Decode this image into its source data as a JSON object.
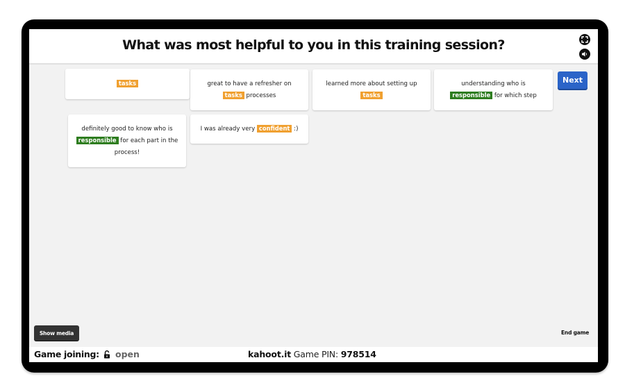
{
  "header": {
    "question": "What was most helpful to you in this training session?",
    "fullscreen_icon": "fullscreen-icon",
    "volume_icon": "volume-icon"
  },
  "responses": [
    {
      "parts": [
        {
          "text": "tasks",
          "kw": "orange"
        }
      ]
    },
    {
      "parts": [
        {
          "text": "great to have a refresher on "
        },
        {
          "text": "tasks",
          "kw": "orange"
        },
        {
          "text": " processes"
        }
      ]
    },
    {
      "parts": [
        {
          "text": "learned more about setting up "
        },
        {
          "text": "tasks",
          "kw": "orange"
        }
      ]
    },
    {
      "parts": [
        {
          "text": "understanding who is "
        },
        {
          "text": "responsible",
          "kw": "green"
        },
        {
          "text": " for which step"
        }
      ]
    },
    {
      "parts": [
        {
          "text": "definitely good to know who is "
        },
        {
          "text": "responsible",
          "kw": "green"
        },
        {
          "text": " for each part in the process!"
        }
      ]
    },
    {
      "parts": [
        {
          "text": "I was already very "
        },
        {
          "text": "confident",
          "kw": "orange"
        },
        {
          "text": " :)"
        }
      ]
    }
  ],
  "controls": {
    "next_label": "Next",
    "show_media_label": "Show media",
    "end_game_label": "End game"
  },
  "footer": {
    "joining_label": "Game joining:",
    "lock_icon": "unlocked-icon",
    "joining_status": "open",
    "host": "kahoot.it",
    "pin_label": "Game PIN:",
    "pin": "978514"
  },
  "colors": {
    "keyword_orange": "#f0a030",
    "keyword_green": "#2e7d1f",
    "next_button": "#2b64c8",
    "show_media_button": "#333333"
  }
}
